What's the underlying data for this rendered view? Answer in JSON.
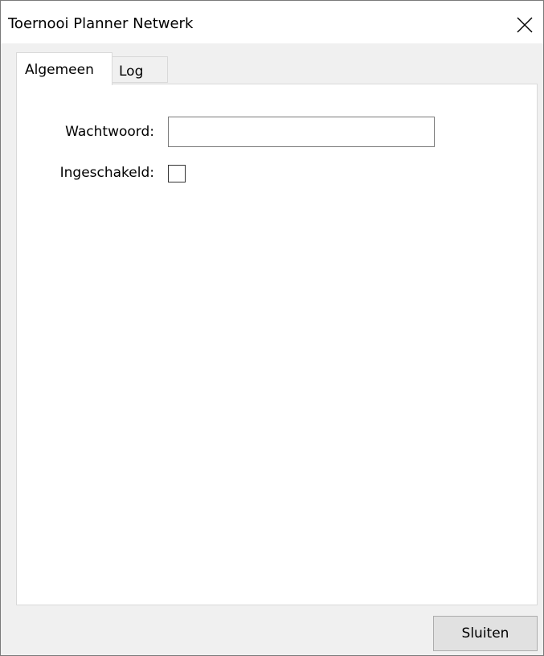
{
  "window": {
    "title": "Toernooi Planner Netwerk",
    "close_icon": "close-icon"
  },
  "tabs": [
    {
      "label": "Algemeen",
      "active": true
    },
    {
      "label": "Log",
      "active": false
    }
  ],
  "form": {
    "password_label": "Wachtwoord:",
    "password_value": "",
    "enabled_label": "Ingeschakeld:",
    "enabled_checked": false
  },
  "footer": {
    "close_label": "Sluiten"
  },
  "colors": {
    "window_bg": "#f0f0f0",
    "panel_bg": "#ffffff",
    "button_bg": "#e1e1e1",
    "border": "#7a7a7a"
  }
}
